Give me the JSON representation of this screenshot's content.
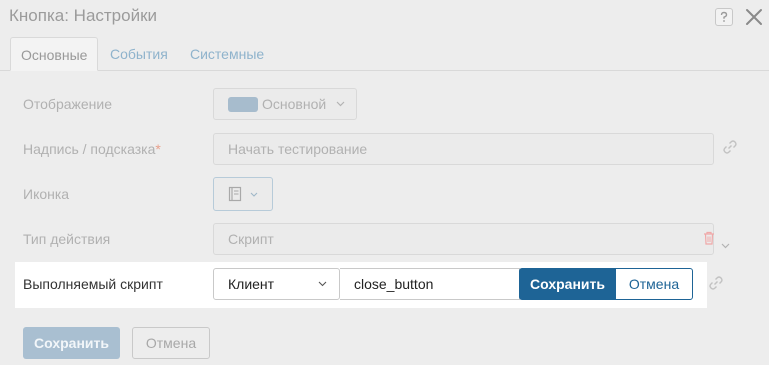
{
  "dialog": {
    "title": "Кнопка: Настройки",
    "help_icon": "question-icon",
    "close_icon": "close-icon"
  },
  "tabs": [
    {
      "label": "Основные",
      "active": true
    },
    {
      "label": "События",
      "active": false
    },
    {
      "label": "Системные",
      "active": false
    }
  ],
  "form": {
    "display": {
      "label": "Отображение",
      "value": "Основной",
      "swatch_color": "#a7bccd"
    },
    "caption": {
      "label": "Надпись / подсказка",
      "required_mark": "*",
      "value": "Начать тестирование"
    },
    "icon": {
      "label": "Иконка",
      "icon": "book-icon"
    },
    "action_type": {
      "label": "Тип действия",
      "value": "Скрипт"
    },
    "script": {
      "label": "Выполняемый скрипт",
      "side": "Клиент",
      "value": "close_button",
      "save_label": "Сохранить",
      "cancel_label": "Отмена"
    }
  },
  "footer": {
    "save_label": "Сохранить",
    "cancel_label": "Отмена"
  },
  "colors": {
    "accent": "#1e6496",
    "accent_disabled": "#a9bfd1",
    "tab_link": "#8fb3cc",
    "required": "#e8a08c",
    "delete": "#f0a8a8"
  }
}
